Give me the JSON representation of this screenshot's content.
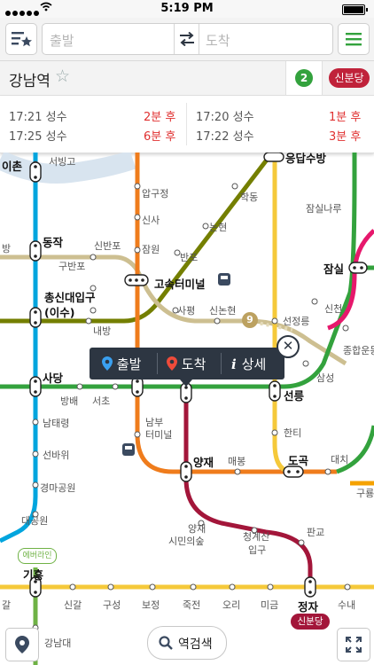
{
  "status_bar": {
    "time": "5:19 PM"
  },
  "toolbar": {
    "origin_placeholder": "출발",
    "destination_placeholder": "도착"
  },
  "station": {
    "name": "강남역",
    "line_badge": "2",
    "other_line_tab": "신분당"
  },
  "arrivals": [
    {
      "time": "17:21",
      "dest": "성수",
      "eta": "2분 후"
    },
    {
      "time": "17:20",
      "dest": "성수",
      "eta": "1분 후"
    },
    {
      "time": "17:25",
      "dest": "성수",
      "eta": "6분 후"
    },
    {
      "time": "17:22",
      "dest": "성수",
      "eta": "3분 후"
    }
  ],
  "popup": {
    "origin": "출발",
    "destination": "도착",
    "detail": "상세"
  },
  "map": {
    "line9_badge": "9",
    "everline_badge": "에버라인",
    "sinbundang_badge": "신분당",
    "stations": {
      "iichon": "이촌",
      "seobinggo": "서빙고",
      "seongsu_partial": "응답수방",
      "apgujeong": "압구정",
      "hakdong": "학동",
      "jamsilnaru": "잠실나루",
      "dongjak": "동작",
      "sinbanpo": "신반포",
      "sinsa": "신사",
      "nonhyeon": "논현",
      "gubanpo": "구반포",
      "jamwon": "잠원",
      "banpo": "반포",
      "jamsil": "잠실",
      "chongsin": "총신대입구",
      "isu": "(이수)",
      "express_terminal": "고속터미널",
      "sinchon": "신천",
      "naebang": "내방",
      "sapyeong": "사평",
      "sinnonhyeon": "신논현",
      "seonjeongneung": "선정릉",
      "sports_complex": "종합운동",
      "sadang": "사당",
      "bangbae": "방배",
      "seocho": "서초",
      "seolleung": "선릉",
      "samseong": "삼성",
      "namtaeryeong": "남태령",
      "nambu_terminal_1": "남부",
      "nambu_terminal_2": "터미널",
      "hanti": "한티",
      "seonbawi": "선바위",
      "yangjae": "양재",
      "maebong": "매봉",
      "dogok": "도곡",
      "daechi": "대치",
      "guryong": "구룡",
      "gyeongma": "경마공원",
      "daegongwon": "대공원",
      "yangjae_forest_1": "양재",
      "yangjae_forest_2": "시민의숲",
      "cheonggyesan_1": "청계산",
      "cheonggyesan_2": "입구",
      "pangyo": "판교",
      "giheung": "기흥",
      "jeongja": "정자",
      "gal": "갈",
      "singal": "신갈",
      "guseong": "구성",
      "bojeong": "보정",
      "jukjeon": "죽전",
      "ori": "오리",
      "migeum": "미금",
      "sunae": "수내",
      "gangnamdae": "강남대",
      "bang": "방"
    }
  },
  "bottom": {
    "search_label": "역검색"
  },
  "colors": {
    "line2": "#33a23d",
    "line3": "#ef7c1c",
    "line4": "#00a5de",
    "line7": "#747f00",
    "line9": "#bdb092",
    "bundang": "#f5a200",
    "sinbundang": "#c0223a",
    "everline": "#6fb245",
    "suin": "#f5c93a",
    "popup_bg": "#2d3642"
  }
}
